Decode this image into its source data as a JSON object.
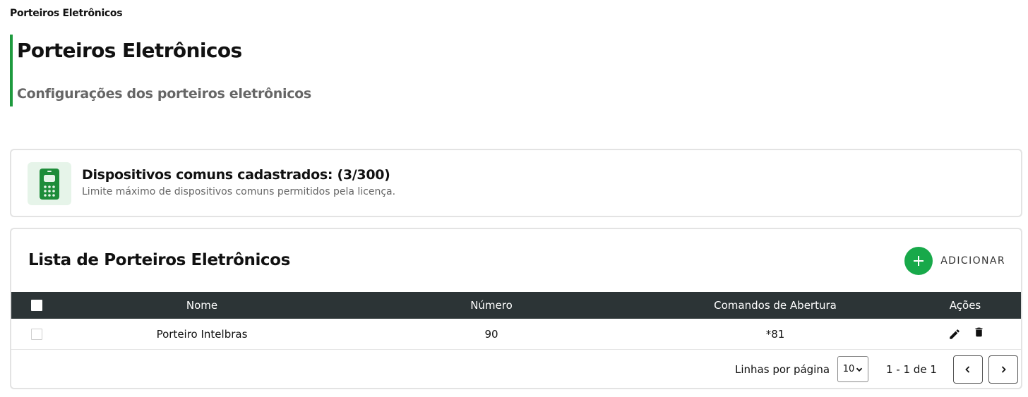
{
  "breadcrumb": "Porteiros Eletrônicos",
  "header": {
    "title": "Porteiros Eletrônicos",
    "subtitle": "Configurações dos porteiros eletrônicos"
  },
  "info": {
    "icon": "intercom-device-icon",
    "title": "Dispositivos comuns cadastrados: (3/300)",
    "subtitle": "Limite máximo de dispositivos comuns permitidos pela licença."
  },
  "list": {
    "title": "Lista de Porteiros Eletrônicos",
    "add_label": "ADICIONAR",
    "columns": [
      "Nome",
      "Número",
      "Comandos de Abertura",
      "Ações"
    ],
    "rows": [
      {
        "nome": "Porteiro Intelbras",
        "numero": "90",
        "comandos": "*81"
      }
    ]
  },
  "pagination": {
    "rows_label": "Linhas por página",
    "rows_per_page": "10",
    "range": "1 - 1 de 1"
  },
  "colors": {
    "accent": "#1e9a3e",
    "add_button": "#18a94a",
    "table_header": "#2c3436",
    "icon_bg": "#e6f4e9"
  }
}
